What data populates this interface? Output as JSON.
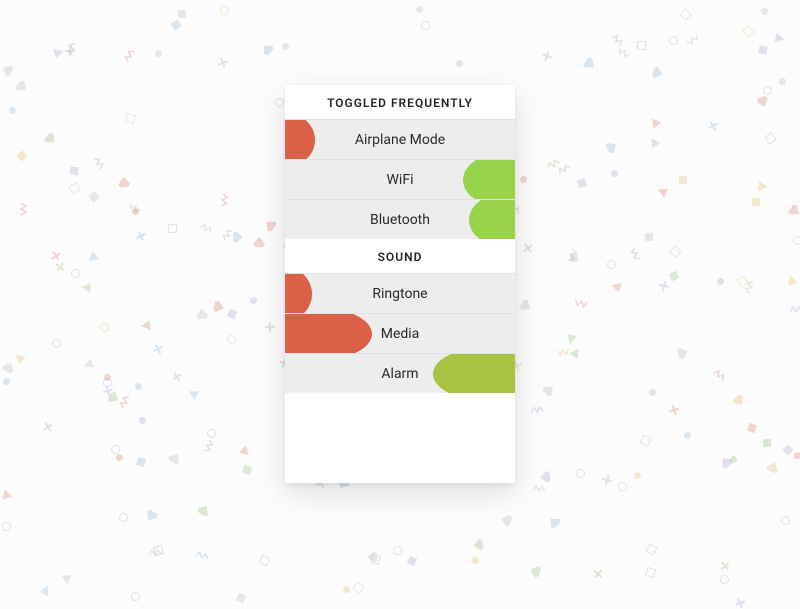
{
  "sections": [
    {
      "title": "TOGGLED FREQUENTLY",
      "rows": [
        {
          "label": "Airplane Mode",
          "side": "left",
          "color": "red",
          "size": 58
        },
        {
          "label": "WiFi",
          "side": "right",
          "color": "green",
          "size": 80
        },
        {
          "label": "Bluetooth",
          "side": "right",
          "color": "green",
          "size": 74
        }
      ]
    },
    {
      "title": "SOUND",
      "rows": [
        {
          "label": "Ringtone",
          "side": "left",
          "color": "red",
          "size": 55
        },
        {
          "label": "Media",
          "side": "left",
          "color": "red",
          "size": 115
        },
        {
          "label": "Alarm",
          "side": "right",
          "color": "olive",
          "size": 110
        }
      ]
    }
  ],
  "palette": {
    "red": "#dc6046",
    "green": "#97d44b",
    "olive": "#a7c341",
    "rowBg": "#ededed",
    "cardBg": "#ffffff"
  }
}
